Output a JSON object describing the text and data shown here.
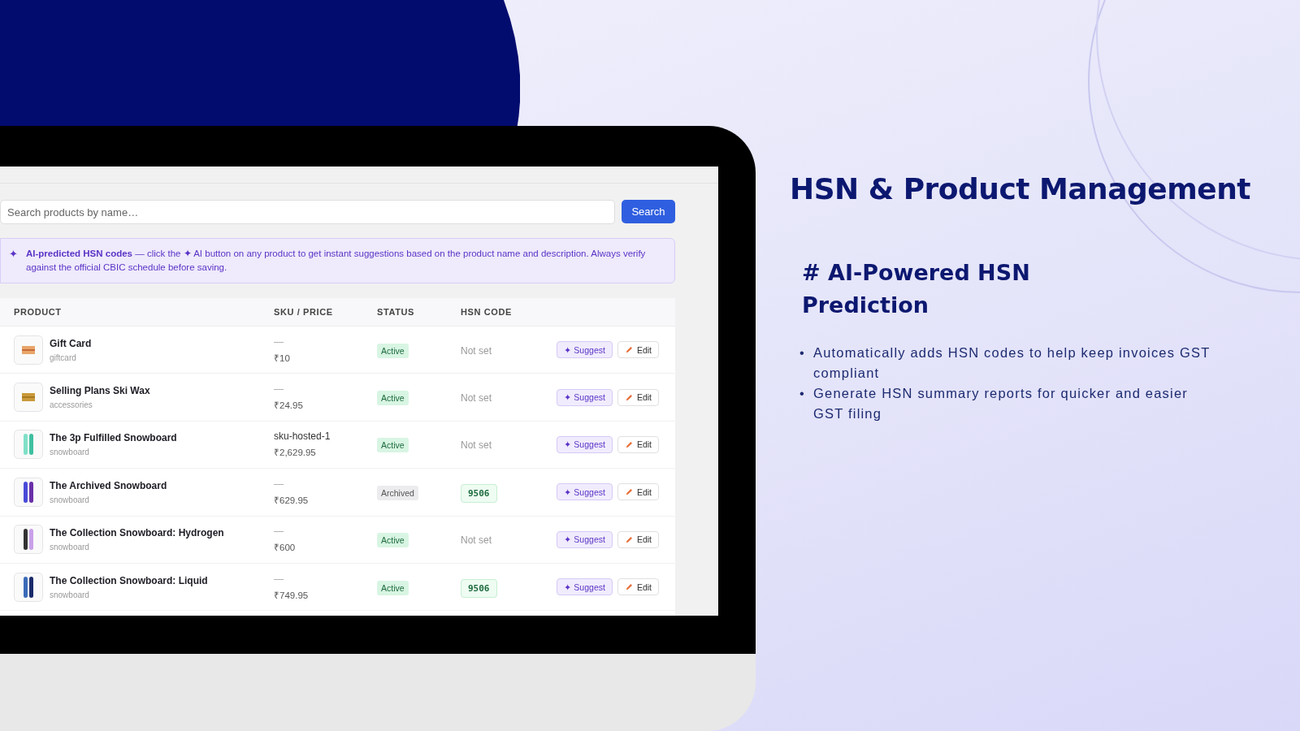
{
  "search": {
    "placeholder": "Search products by name…",
    "button": "Search"
  },
  "banner": {
    "icon": "✦",
    "text": "**AI-predicted HSN codes** — click the ✦ AI button on any product to get instant suggestions based on the product name and description. Always verify against the official CBIC schedule before saving."
  },
  "table": {
    "columns": [
      "PRODUCT",
      "SKU / PRICE",
      "STATUS",
      "HSN CODE"
    ],
    "rows": [
      {
        "name": "Gift Card",
        "category": "giftcard",
        "sku": "—",
        "price": "₹10",
        "status": {
          "label": "Active",
          "kind": "active"
        },
        "hsn": {
          "text": "Not set",
          "kind": "unset"
        },
        "suggest": "✦ Suggest",
        "edit": "Edit"
      },
      {
        "name": "Selling Plans Ski Wax",
        "category": "accessories",
        "sku": "—",
        "price": "₹24.95",
        "status": {
          "label": "Active",
          "kind": "active"
        },
        "hsn": {
          "text": "Not set",
          "kind": "unset"
        },
        "suggest": "✦ Suggest",
        "edit": "Edit"
      },
      {
        "name": "The 3p Fulfilled Snowboard",
        "category": "snowboard",
        "sku": "sku-hosted-1",
        "price": "₹2,629.95",
        "status": {
          "label": "Active",
          "kind": "active"
        },
        "hsn": {
          "text": "Not set",
          "kind": "unset"
        },
        "suggest": "✦ Suggest",
        "edit": "Edit"
      },
      {
        "name": "The Archived Snowboard",
        "category": "snowboard",
        "sku": "—",
        "price": "₹629.95",
        "status": {
          "label": "Archived",
          "kind": "archived"
        },
        "hsn": {
          "text": "9506",
          "kind": "code"
        },
        "suggest": "✦ Suggest",
        "edit": "Edit"
      },
      {
        "name": "The Collection Snowboard: Hydrogen",
        "category": "snowboard",
        "sku": "—",
        "price": "₹600",
        "status": {
          "label": "Active",
          "kind": "active"
        },
        "hsn": {
          "text": "Not set",
          "kind": "unset"
        },
        "suggest": "✦ Suggest",
        "edit": "Edit"
      },
      {
        "name": "The Collection Snowboard: Liquid",
        "category": "snowboard",
        "sku": "—",
        "price": "₹749.95",
        "status": {
          "label": "Active",
          "kind": "active"
        },
        "hsn": {
          "text": "9506",
          "kind": "code"
        },
        "suggest": "✦ Suggest",
        "edit": "Edit"
      }
    ]
  },
  "title": "HSN & Product Management",
  "subtitle": "# AI-Powered HSN Prediction",
  "bullets": [
    {
      "marker": "•",
      "text": "Automatically adds HSN codes to help keep invoices GST compliant"
    },
    {
      "marker": "•",
      "text": "Generate HSN summary reports for quicker and easier GST filing"
    }
  ]
}
